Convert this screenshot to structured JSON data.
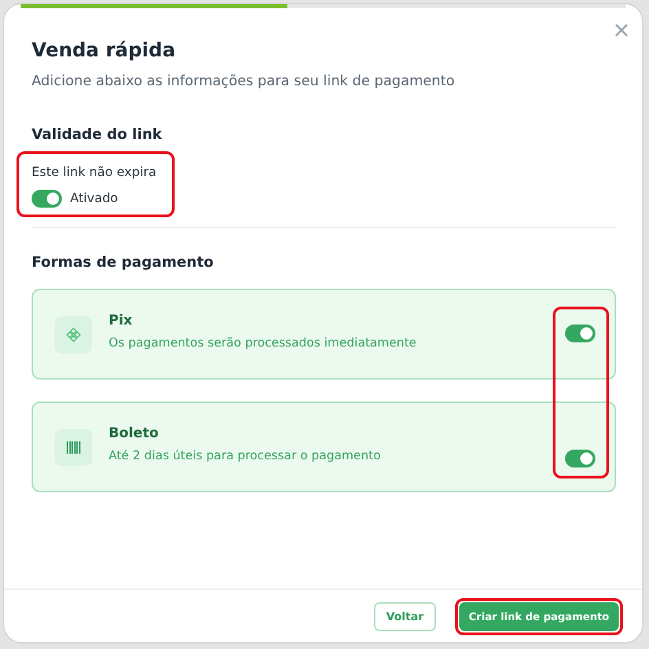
{
  "progress": {
    "level": 0.44
  },
  "dialog": {
    "title": "Venda rápida",
    "subtitle": "Adicione abaixo as informações para seu link de pagamento"
  },
  "validity": {
    "heading": "Validade do link",
    "label": "Este link não expira",
    "toggle_on": true,
    "toggle_text": "Ativado",
    "highlighted": true
  },
  "payment": {
    "heading": "Formas de pagamento",
    "toggles_highlighted": true,
    "methods": [
      {
        "kind": "pix",
        "name": "Pix",
        "description": "Os pagamentos serão processados imediatamente",
        "on": true
      },
      {
        "kind": "boleto",
        "name": "Boleto",
        "description": "Até 2 dias úteis para processar o pagamento",
        "on": true
      }
    ]
  },
  "buttons": [
    {
      "kind": "secondary",
      "label": "Voltar",
      "highlighted": false
    },
    {
      "kind": "primary",
      "label": "Criar link de pagamento",
      "highlighted": true
    }
  ]
}
